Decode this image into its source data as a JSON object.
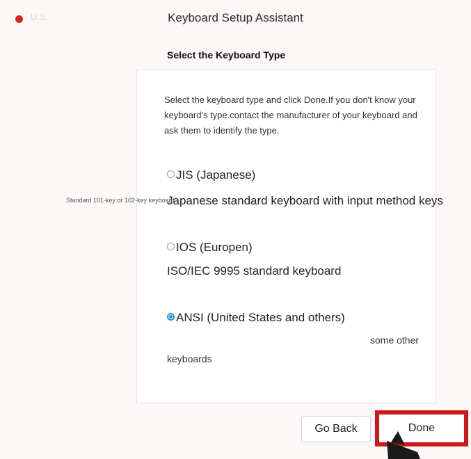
{
  "window": {
    "title": "Keyboard Setup Assistant",
    "title_faded": "U.S."
  },
  "header": {
    "subtitle": "Select the Keyboard Type"
  },
  "instructions": "Select the keyboard type and click Done.If you don't know your keyboard's type.contact the manufacturer of your keyboard and ask them to identify the type.",
  "side_note": "Standard 101-key or 102-key keyboard",
  "options": [
    {
      "label": "JIS  (Japanese)",
      "desc": "Japanese standard keyboard with input method keys",
      "selected": false
    },
    {
      "label": "IOS  (Europen)",
      "desc": "ISO/IEC 9995 standard keyboard",
      "selected": false
    },
    {
      "label": "ANSI  (United States and others)",
      "desc": "some other keyboards",
      "desc_part1": "some other",
      "desc_part2": "keyboards",
      "selected": true
    }
  ],
  "buttons": {
    "back": "Go Back",
    "done": "Done"
  },
  "colors": {
    "close_dot": "#e0201c",
    "highlight_border": "#d0171a",
    "radio_selected": "#2c8fd8"
  }
}
